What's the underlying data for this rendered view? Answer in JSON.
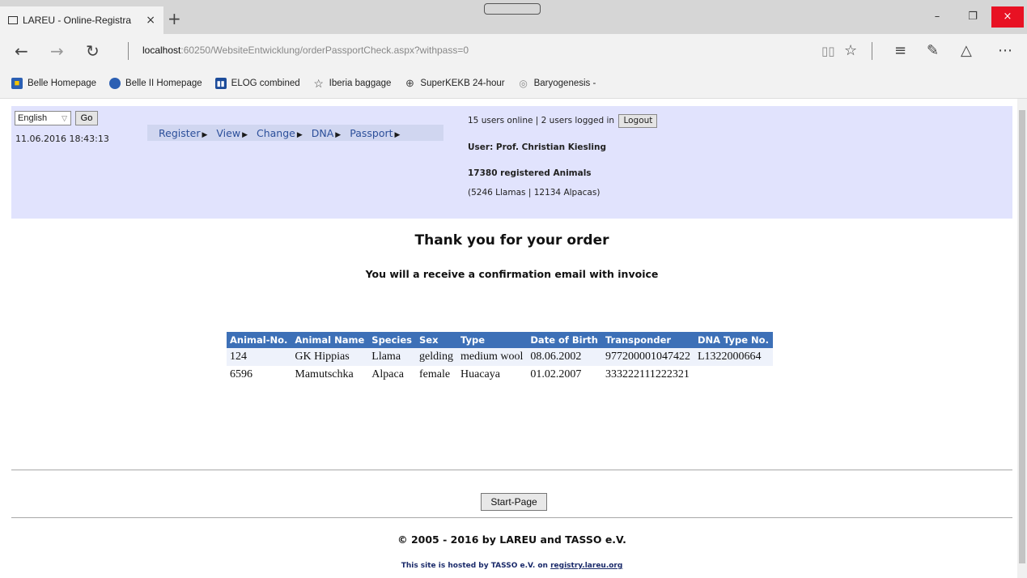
{
  "browser": {
    "tab_title": "LAREU - Online-Registra",
    "tab_close": "×",
    "new_tab": "+",
    "url_host": "localhost",
    "url_rest": ":60250/WebsiteEntwicklung/orderPassportCheck.aspx?withpass=0",
    "window": {
      "minimize": "–",
      "maximize": "❐",
      "close": "×"
    },
    "nav_icons": [
      "back-icon",
      "forward-icon",
      "refresh-icon"
    ],
    "right_icons": [
      "reading-view-icon",
      "favorite-star-icon",
      "hub-icon",
      "web-note-icon",
      "share-icon",
      "more-icon"
    ],
    "bookmarks": [
      {
        "label": "Belle Homepage",
        "icon": "belle-icon",
        "color": "#2b5fb3"
      },
      {
        "label": "Belle II Homepage",
        "icon": "belle2-icon",
        "color": "#2b5fb3"
      },
      {
        "label": "ELOG combined",
        "icon": "elog-icon",
        "color": "#1d4c9a"
      },
      {
        "label": "Iberia baggage",
        "icon": "star-outline-icon",
        "color": "#444444"
      },
      {
        "label": "SuperKEKB 24-hour",
        "icon": "globe-icon",
        "color": "#444444"
      },
      {
        "label": "Baryogenesis -",
        "icon": "baryo-icon",
        "color": "#888888"
      }
    ]
  },
  "header": {
    "language": "English",
    "go_label": "Go",
    "datetime": "11.06.2016 18:43:13",
    "menu": [
      "Register",
      "View",
      "Change",
      "DNA",
      "Passport"
    ],
    "menu_arrow": "▶",
    "status_text": "15 users online | 2 users logged in",
    "logout_label": "Logout",
    "user_line": "User: Prof. Christian Kiesling",
    "registered": "17380 registered Animals",
    "registered_sub": "(5246 Llamas | 12134 Alpacas)"
  },
  "main": {
    "title": "Thank you for your order",
    "subtitle": "You will a receive a confirmation email with invoice",
    "table": {
      "columns": [
        "Animal-No.",
        "Animal Name",
        "Species",
        "Sex",
        "Type",
        "Date of Birth",
        "Transponder",
        "DNA Type No."
      ],
      "rows": [
        [
          "124",
          "GK Hippias",
          "Llama",
          "gelding",
          "medium wool",
          "08.06.2002",
          "977200001047422",
          "L1322000664"
        ],
        [
          "6596",
          "Mamutschka",
          "Alpaca",
          "female",
          "Huacaya",
          "01.02.2007",
          "333222111222321",
          ""
        ]
      ]
    }
  },
  "footer": {
    "start_label": "Start-Page",
    "copyright": "© 2005 - 2016 by LAREU and TASSO e.V.",
    "hosted_prefix": "This site is hosted by TASSO e.V. on ",
    "hosted_link": "registry.lareu.org"
  },
  "colors": {
    "header_band": "#e1e3fd",
    "menu_bar": "#d0d6f0",
    "table_header": "#3d70b7",
    "table_odd_row": "#eef2fb"
  }
}
